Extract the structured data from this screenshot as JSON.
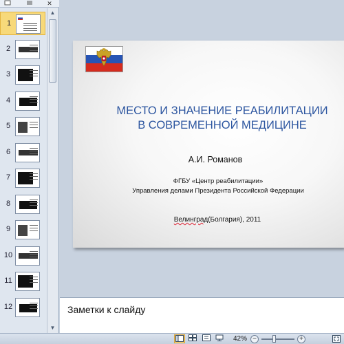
{
  "thumbnail_pane": {
    "tabs": {
      "slides_icon": "slides-tab-icon",
      "outline_icon": "outline-tab-icon",
      "close_label": "✕"
    },
    "slides": [
      {
        "number": "1",
        "selected": true
      },
      {
        "number": "2",
        "selected": false
      },
      {
        "number": "3",
        "selected": false
      },
      {
        "number": "4",
        "selected": false
      },
      {
        "number": "5",
        "selected": false
      },
      {
        "number": "6",
        "selected": false
      },
      {
        "number": "7",
        "selected": false
      },
      {
        "number": "8",
        "selected": false
      },
      {
        "number": "9",
        "selected": false
      },
      {
        "number": "10",
        "selected": false
      },
      {
        "number": "11",
        "selected": false
      },
      {
        "number": "12",
        "selected": false
      }
    ],
    "scroll_up_glyph": "▲",
    "scroll_down_glyph": "▼"
  },
  "slide": {
    "title_line1": "МЕСТО И ЗНАЧЕНИЕ РЕАБИЛИТАЦИИ",
    "title_line2": "В СОВРЕМЕННОЙ МЕДИЦИНЕ",
    "author": "А.И. Романов",
    "org_line1": "ФГБУ «Центр реабилитации»",
    "org_line2": "Управления делами Президента Российской Федерации",
    "place_city": "Велинград",
    "place_rest": "(Болгария), 2011",
    "title_color": "#2d56a0"
  },
  "notes": {
    "placeholder": "Заметки к слайду"
  },
  "status_bar": {
    "zoom": "42%",
    "zoom_out_glyph": "−",
    "zoom_in_glyph": "+",
    "zoom_fraction": 0.42
  }
}
